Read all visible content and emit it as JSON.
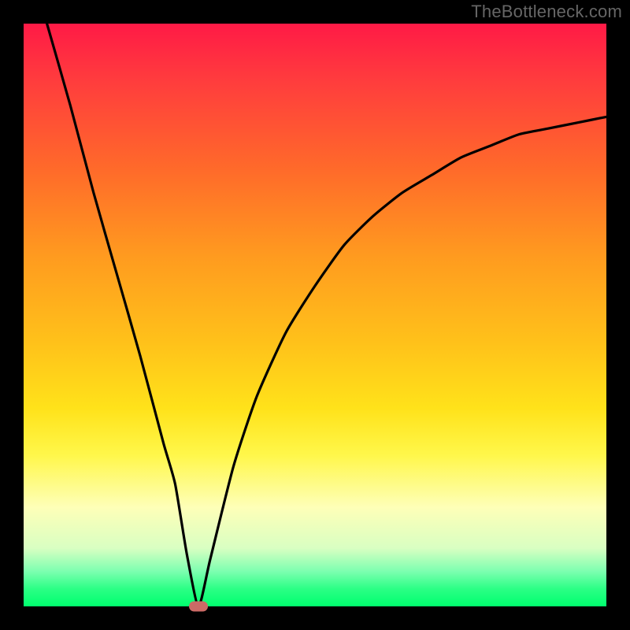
{
  "watermark": "TheBottleneck.com",
  "chart_data": {
    "type": "line",
    "title": "",
    "xlabel": "",
    "ylabel": "",
    "xlim": [
      0,
      100
    ],
    "ylim": [
      0,
      100
    ],
    "background_gradient": {
      "top": "#ff1a46",
      "middle": "#ffe21a",
      "bottom": "#00ff6e"
    },
    "series": [
      {
        "name": "bottleneck-curve",
        "color": "#000000",
        "x": [
          4,
          8,
          12,
          16,
          20,
          24,
          26,
          28,
          30,
          32,
          36,
          40,
          45,
          50,
          55,
          60,
          65,
          70,
          75,
          80,
          85,
          90,
          95,
          100
        ],
        "y": [
          100,
          86,
          71,
          57,
          43,
          28,
          21,
          9,
          0,
          8,
          24,
          36,
          47,
          55,
          62,
          67,
          71,
          74,
          77,
          79,
          81,
          82,
          83,
          84
        ]
      }
    ],
    "marker": {
      "name": "optimal-point",
      "x": 30,
      "y": 0,
      "color": "#cc6a66"
    }
  }
}
